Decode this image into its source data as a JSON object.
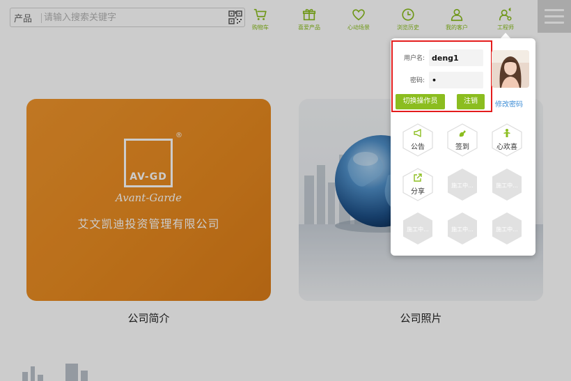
{
  "search": {
    "category": "产品",
    "placeholder": "请输入搜索关键字"
  },
  "nav": [
    {
      "label": "购物车",
      "icon": "cart-icon"
    },
    {
      "label": "喜爱产品",
      "icon": "gift-icon"
    },
    {
      "label": "心动场景",
      "icon": "heart-icon"
    },
    {
      "label": "浏览历史",
      "icon": "clock-icon"
    },
    {
      "label": "我的客户",
      "icon": "user-icon"
    },
    {
      "label": "工程师",
      "icon": "engineer-icon"
    }
  ],
  "menu_icon": "hamburger-icon",
  "cards": [
    {
      "caption": "公司简介",
      "logo": {
        "text": "AV-GD",
        "reg": "®",
        "script": "Avant-Garde",
        "company": "艾文凯迪投资管理有限公司"
      }
    },
    {
      "caption": "公司照片"
    }
  ],
  "popup": {
    "username_label": "用户名:",
    "username_value": "deng1",
    "password_label": "密码:",
    "password_value": "•",
    "switch_label": "切换操作员",
    "logout_label": "注销",
    "change_pw_label": "修改密码",
    "tiles": [
      {
        "label": "公告",
        "icon": "megaphone-icon",
        "active": true
      },
      {
        "label": "签到",
        "icon": "signin-icon",
        "active": true
      },
      {
        "label": "心欢喜",
        "icon": "person-icon",
        "active": true
      },
      {
        "label": "分享",
        "icon": "share-icon",
        "active": true
      },
      {
        "label": "施工中...",
        "active": false
      },
      {
        "label": "施工中...",
        "active": false
      },
      {
        "label": "施工中...",
        "active": false
      },
      {
        "label": "施工中...",
        "active": false
      },
      {
        "label": "施工中...",
        "active": false
      }
    ]
  },
  "colors": {
    "accent": "#8bbd1f",
    "highlight": "#e41c1c",
    "link": "#3f8ed6",
    "orange": "#ec8e24"
  }
}
